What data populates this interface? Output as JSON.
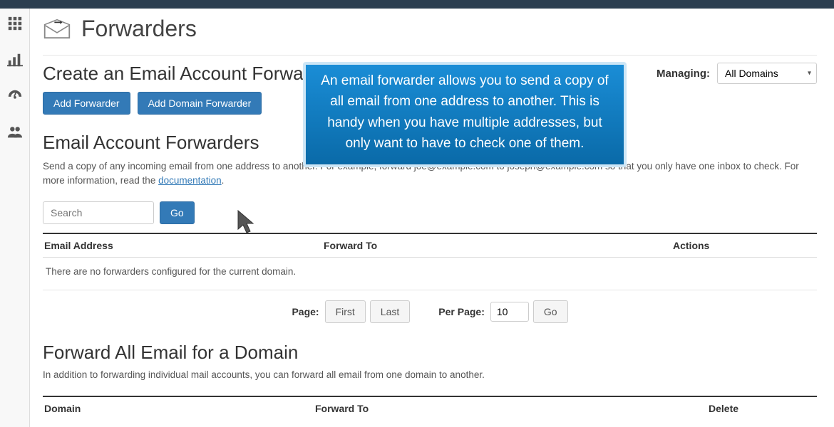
{
  "page": {
    "title": "Forwarders"
  },
  "subsection": {
    "title": "Create an Email Account Forwarder",
    "managing_label": "Managing:",
    "managing_value": "All Domains"
  },
  "buttons": {
    "add_forwarder": "Add Forwarder",
    "add_domain_forwarder": "Add Domain Forwarder"
  },
  "forwarders_section": {
    "title": "Email Account Forwarders",
    "desc_before": "Send a copy of any incoming email from one address to another. For example, forward joe@example.com to joseph@example.com so that you only have one inbox to check. For more information, read the ",
    "desc_link": "documentation",
    "desc_after": ".",
    "search_placeholder": "Search",
    "go_label": "Go",
    "headers": {
      "email": "Email Address",
      "forward_to": "Forward To",
      "actions": "Actions"
    },
    "empty": "There are no forwarders configured for the current domain."
  },
  "pagination": {
    "page_label": "Page:",
    "first": "First",
    "last": "Last",
    "per_page_label": "Per Page:",
    "per_page_value": "10",
    "go": "Go"
  },
  "domain_section": {
    "title": "Forward All Email for a Domain",
    "desc": "In addition to forwarding individual mail accounts, you can forward all email from one domain to another.",
    "headers": {
      "domain": "Domain",
      "forward_to": "Forward To",
      "delete": "Delete"
    }
  },
  "tooltip": {
    "text": "An email forwarder allows you to send a copy of all email from one address to another. This is handy when you have multiple addresses, but only want to have to check one of them."
  }
}
